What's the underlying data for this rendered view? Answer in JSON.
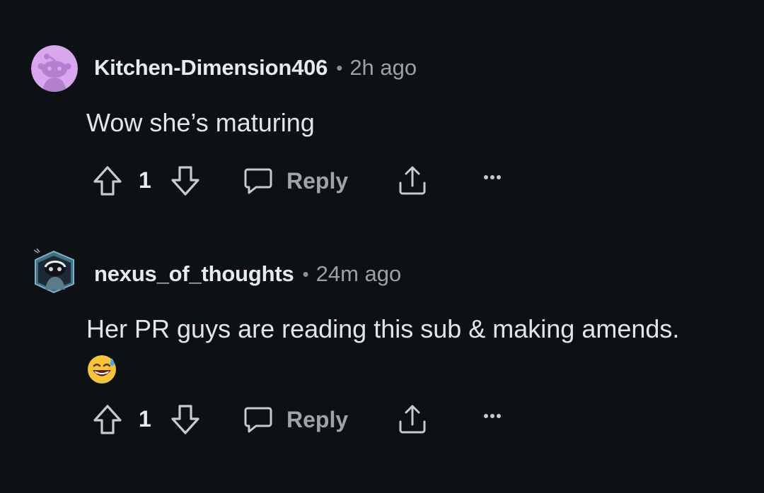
{
  "comments": [
    {
      "username": "Kitchen-Dimension406",
      "separator": "•",
      "time": "2h ago",
      "body": "Wow she’s maturing",
      "score": "1",
      "reply_label": "Reply",
      "avatar_icon": "snoo-avatar-icon",
      "avatar_color": "#d8a7ee"
    },
    {
      "username": "nexus_of_thoughts",
      "separator": "•",
      "time": "24m ago",
      "body": "Her PR guys are reading this sub & making amends.",
      "emoji": "grinning-sweat-emoji",
      "score": "1",
      "reply_label": "Reply",
      "avatar_icon": "custom-snoo-avatar-icon"
    }
  ],
  "theme": {
    "background": "#0e1113",
    "text": "#d7dadc",
    "muted": "#9ba1a6"
  }
}
